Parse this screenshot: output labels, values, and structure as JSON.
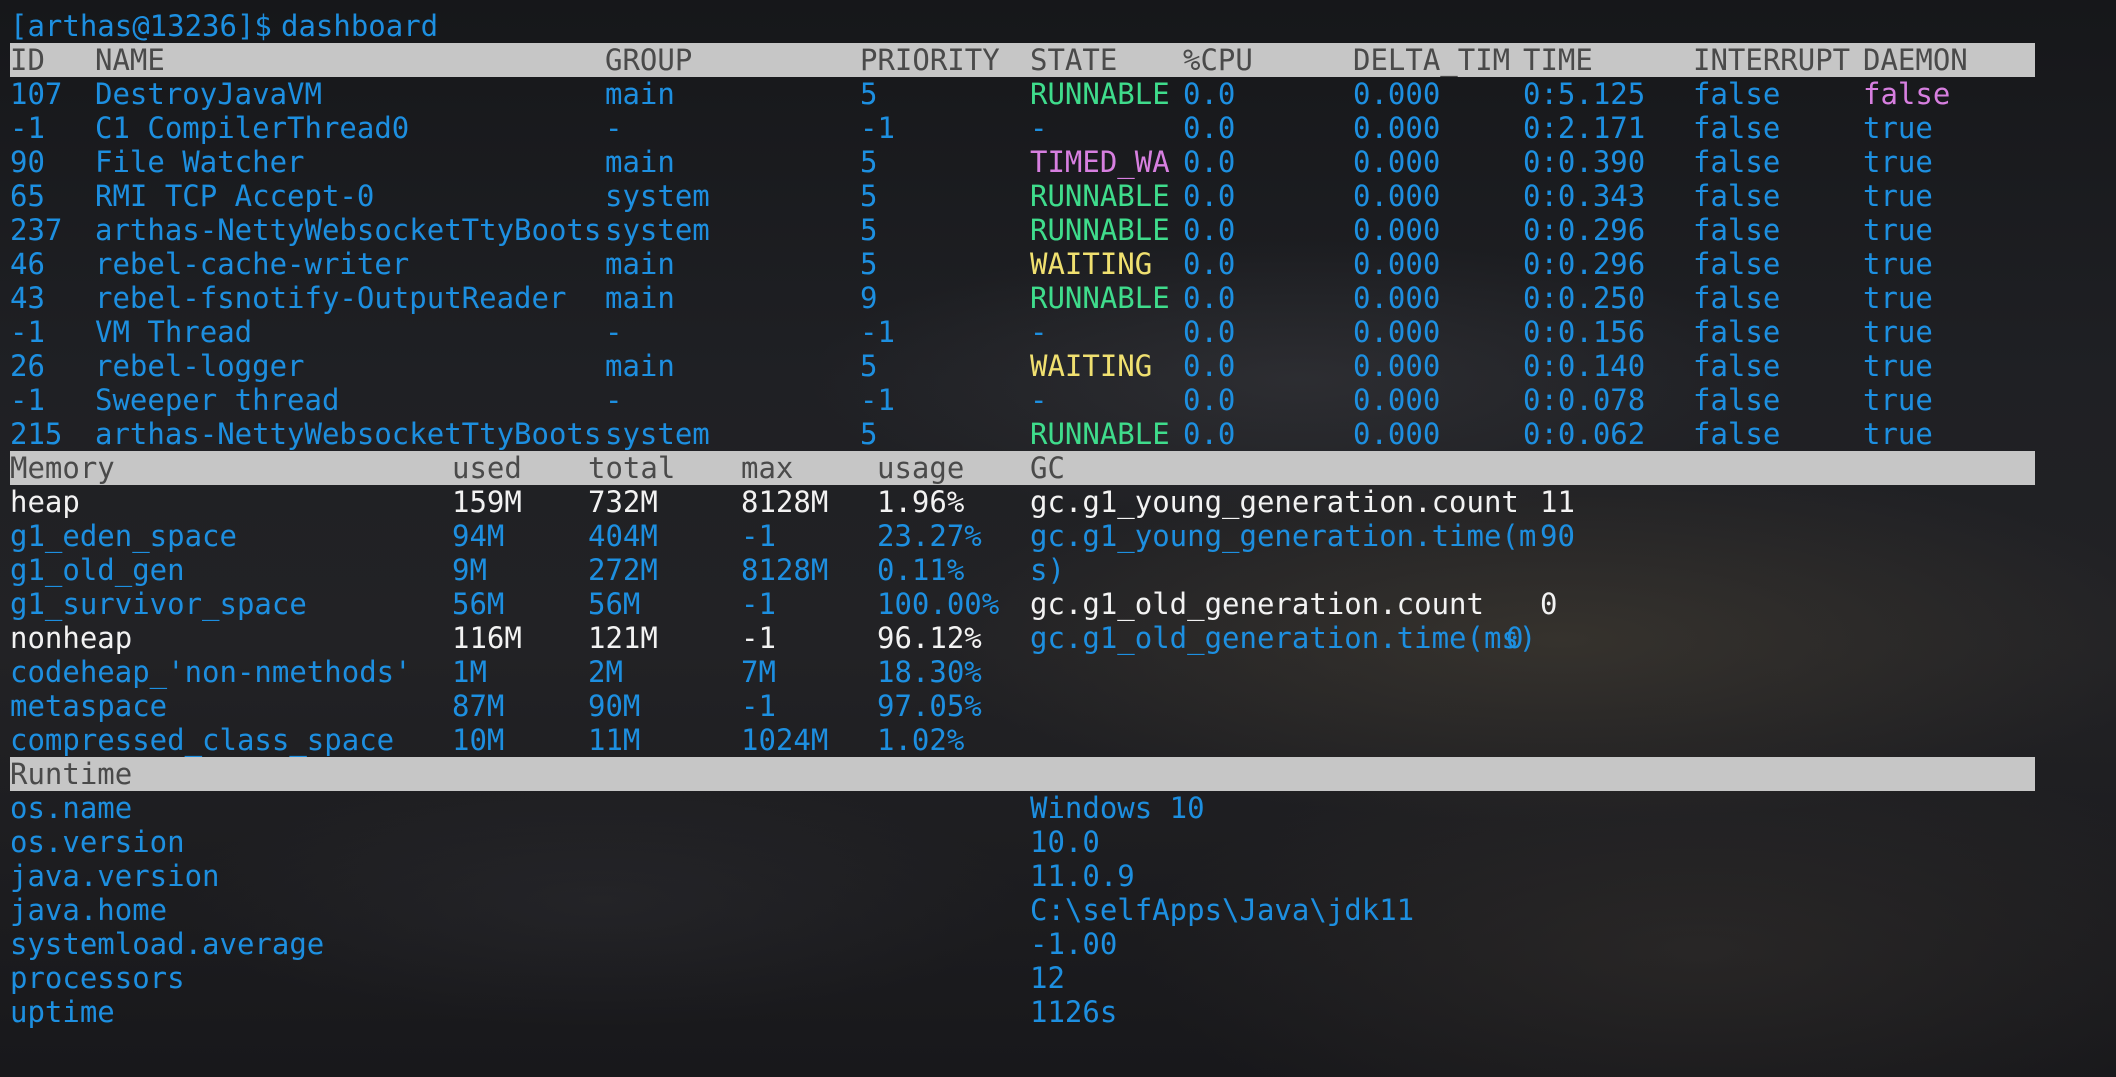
{
  "prompt": {
    "user_host": "[arthas@13236]$",
    "command": "dashboard"
  },
  "colors": {
    "blue": "#1d8fe0",
    "green": "#3fdc8c",
    "magenta": "#d77fe0",
    "yellow": "#f0e070",
    "white": "#f2f2f2",
    "header_bg": "#c6c6c6"
  },
  "threads": {
    "headers": [
      "ID",
      "NAME",
      "GROUP",
      "PRIORITY",
      "STATE",
      "%CPU",
      "DELTA_TIM",
      "TIME",
      "INTERRUPT",
      "DAEMON"
    ],
    "rows": [
      {
        "id": "107",
        "name": "DestroyJavaVM",
        "group": "main",
        "priority": "5",
        "state": "RUNNABLE",
        "cpu": "0.0",
        "delta": "0.000",
        "time": "0:5.125",
        "interrupt": "false",
        "daemon": "false"
      },
      {
        "id": "-1",
        "name": "C1 CompilerThread0",
        "group": "-",
        "priority": "-1",
        "state": "-",
        "cpu": "0.0",
        "delta": "0.000",
        "time": "0:2.171",
        "interrupt": "false",
        "daemon": "true"
      },
      {
        "id": "90",
        "name": "File Watcher",
        "group": "main",
        "priority": "5",
        "state": "TIMED_WA",
        "cpu": "0.0",
        "delta": "0.000",
        "time": "0:0.390",
        "interrupt": "false",
        "daemon": "true"
      },
      {
        "id": "65",
        "name": "RMI TCP Accept-0",
        "group": "system",
        "priority": "5",
        "state": "RUNNABLE",
        "cpu": "0.0",
        "delta": "0.000",
        "time": "0:0.343",
        "interrupt": "false",
        "daemon": "true"
      },
      {
        "id": "237",
        "name": "arthas-NettyWebsocketTtyBoots",
        "group": "system",
        "priority": "5",
        "state": "RUNNABLE",
        "cpu": "0.0",
        "delta": "0.000",
        "time": "0:0.296",
        "interrupt": "false",
        "daemon": "true"
      },
      {
        "id": "46",
        "name": "rebel-cache-writer",
        "group": "main",
        "priority": "5",
        "state": "WAITING",
        "cpu": "0.0",
        "delta": "0.000",
        "time": "0:0.296",
        "interrupt": "false",
        "daemon": "true"
      },
      {
        "id": "43",
        "name": "rebel-fsnotify-OutputReader",
        "group": "main",
        "priority": "9",
        "state": "RUNNABLE",
        "cpu": "0.0",
        "delta": "0.000",
        "time": "0:0.250",
        "interrupt": "false",
        "daemon": "true"
      },
      {
        "id": "-1",
        "name": "VM Thread",
        "group": "-",
        "priority": "-1",
        "state": "-",
        "cpu": "0.0",
        "delta": "0.000",
        "time": "0:0.156",
        "interrupt": "false",
        "daemon": "true"
      },
      {
        "id": "26",
        "name": "rebel-logger",
        "group": "main",
        "priority": "5",
        "state": "WAITING",
        "cpu": "0.0",
        "delta": "0.000",
        "time": "0:0.140",
        "interrupt": "false",
        "daemon": "true"
      },
      {
        "id": "-1",
        "name": "Sweeper thread",
        "group": "-",
        "priority": "-1",
        "state": "-",
        "cpu": "0.0",
        "delta": "0.000",
        "time": "0:0.078",
        "interrupt": "false",
        "daemon": "true"
      },
      {
        "id": "215",
        "name": "arthas-NettyWebsocketTtyBoots",
        "group": "system",
        "priority": "5",
        "state": "RUNNABLE",
        "cpu": "0.0",
        "delta": "0.000",
        "time": "0:0.062",
        "interrupt": "false",
        "daemon": "true"
      }
    ]
  },
  "memory": {
    "headers": [
      "Memory",
      "used",
      "total",
      "max",
      "usage",
      "GC"
    ],
    "rows": [
      {
        "name": "heap",
        "used": "159M",
        "total": "732M",
        "max": "8128M",
        "usage": "1.96%",
        "gc_key": "gc.g1_young_generation.count",
        "gc_val": "11"
      },
      {
        "name": "g1_eden_space",
        "used": "94M",
        "total": "404M",
        "max": "-1",
        "usage": "23.27%",
        "gc_key": "gc.g1_young_generation.time(m",
        "gc_val": "90"
      },
      {
        "name": "g1_old_gen",
        "used": "9M",
        "total": "272M",
        "max": "8128M",
        "usage": "0.11%",
        "gc_key": "s)",
        "gc_val": ""
      },
      {
        "name": "g1_survivor_space",
        "used": "56M",
        "total": "56M",
        "max": "-1",
        "usage": "100.00%",
        "gc_key": "gc.g1_old_generation.count",
        "gc_val": "0"
      },
      {
        "name": "nonheap",
        "used": "116M",
        "total": "121M",
        "max": "-1",
        "usage": "96.12%",
        "gc_key": "gc.g1_old_generation.time(ms)",
        "gc_val": "0"
      },
      {
        "name": "codeheap_'non-nmethods'",
        "used": "1M",
        "total": "2M",
        "max": "7M",
        "usage": "18.30%",
        "gc_key": "",
        "gc_val": ""
      },
      {
        "name": "metaspace",
        "used": "87M",
        "total": "90M",
        "max": "-1",
        "usage": "97.05%",
        "gc_key": "",
        "gc_val": ""
      },
      {
        "name": "compressed_class_space",
        "used": "10M",
        "total": "11M",
        "max": "1024M",
        "usage": "1.02%",
        "gc_key": "",
        "gc_val": ""
      }
    ]
  },
  "runtime": {
    "header": "Runtime",
    "rows": [
      {
        "key": "os.name",
        "value": "Windows 10"
      },
      {
        "key": "os.version",
        "value": "10.0"
      },
      {
        "key": "java.version",
        "value": "11.0.9"
      },
      {
        "key": "java.home",
        "value": "C:\\selfApps\\Java\\jdk11"
      },
      {
        "key": "systemload.average",
        "value": "-1.00"
      },
      {
        "key": "processors",
        "value": "12"
      },
      {
        "key": "uptime",
        "value": "1126s"
      }
    ]
  }
}
